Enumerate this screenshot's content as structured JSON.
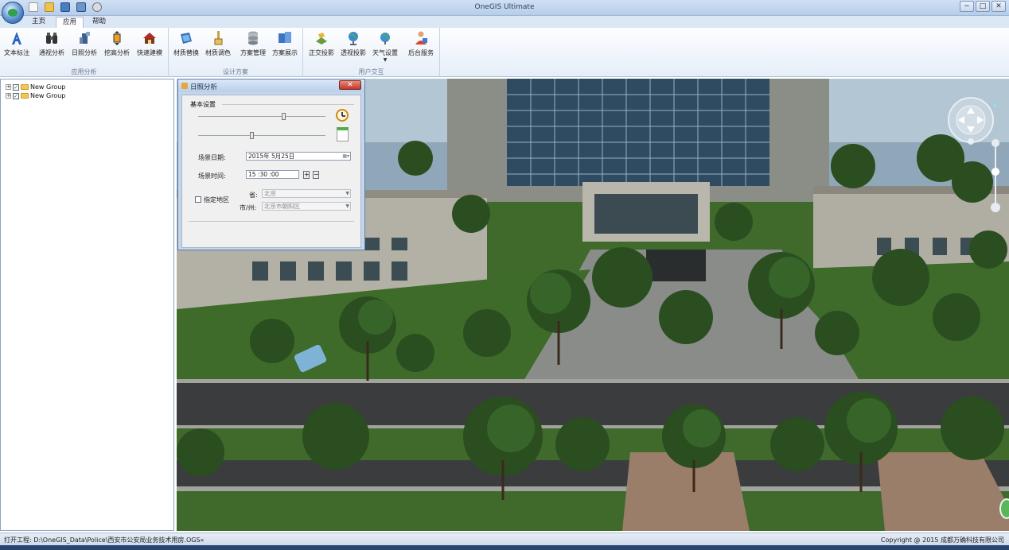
{
  "window": {
    "title": "OneGIS Ultimate",
    "minimize": "−",
    "maximize": "□",
    "close": "✕"
  },
  "tabs": [
    "主页",
    "应用",
    "帮助"
  ],
  "active_tab": "应用",
  "ribbon": {
    "groups": [
      {
        "label": "应用分析",
        "buttons": [
          "文本标注",
          "通视分析",
          "日照分析",
          "挖高分析",
          "快速建模"
        ]
      },
      {
        "label": "设计方案",
        "buttons": [
          "材质替换",
          "材质调色",
          "方案管理",
          "方案展示"
        ]
      },
      {
        "label": "用户交互",
        "buttons": [
          "正交投影",
          "透视投影",
          "天气设置",
          "后台服务"
        ]
      }
    ]
  },
  "tree": {
    "items": [
      {
        "label": "New Group",
        "checked": true
      },
      {
        "label": "New Group",
        "checked": true
      }
    ]
  },
  "dialog": {
    "title": "日照分析",
    "close": "✕",
    "group_label": "基本设置",
    "slider1_level": 0.68,
    "slider2_level": 0.42,
    "date_label": "场景日期:",
    "date_value": "2015年 5月25日",
    "time_label": "场景时间:",
    "time_value": "15 :30 :00",
    "spin_up": "+",
    "spin_down": "−",
    "region_label": "指定地区",
    "province_label": "省:",
    "province_value": "北京",
    "city_label": "市/州:",
    "city_value": "北京市朝阳区"
  },
  "status": {
    "left": "打开工程: D:\\OneGIS_Data\\Police\\西安市公安局业务技术用房.OGS»",
    "right": "Copyright @ 2015 成都万确科技有限公司"
  },
  "colors": {
    "ribbon_bg": "#eaf1fa",
    "dialog_close": "#c0382a",
    "grass": "#3e6b2a",
    "road": "#3a3c3e"
  }
}
